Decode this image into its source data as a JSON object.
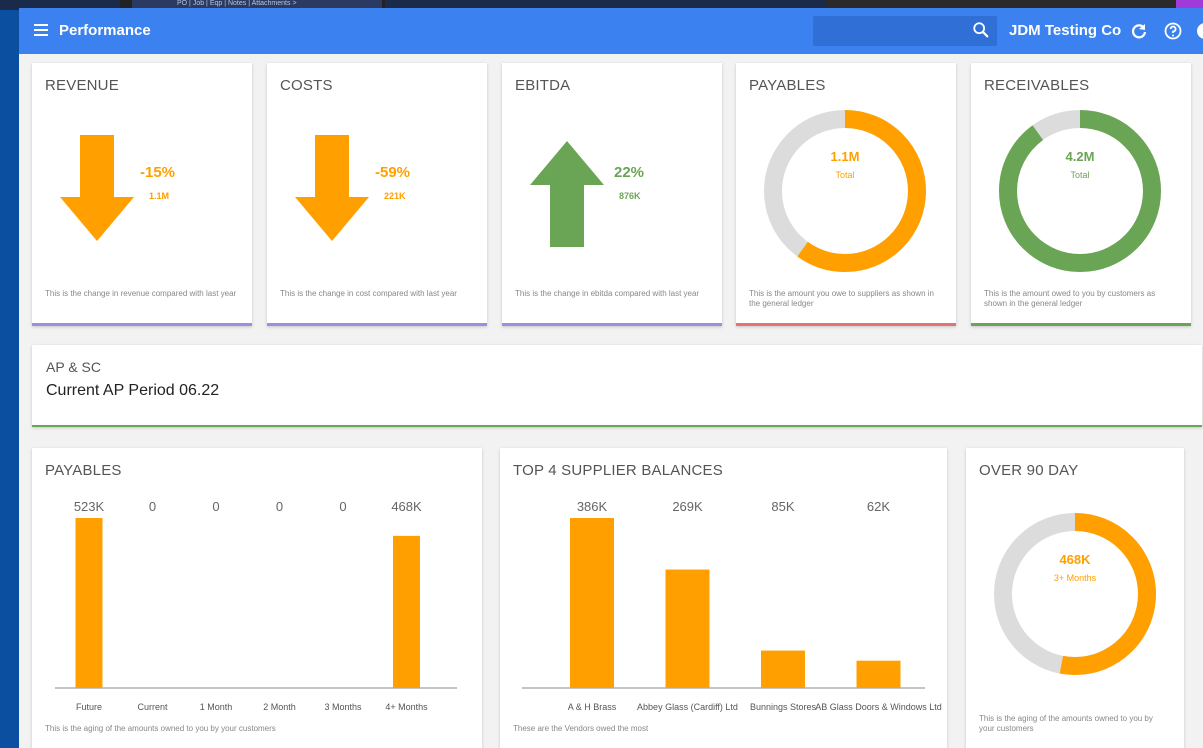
{
  "background_tabs": "PO | Job | Eqp | Notes | Attachments   >",
  "appbar": {
    "title": "Performance",
    "company": "JDM Testing Co",
    "color": "#3b82f0"
  },
  "kpis": {
    "revenue": {
      "title": "REVENUE",
      "direction": "down",
      "percent": "-15%",
      "amount": "1.1M",
      "footer": "This is the change in revenue compared with last year",
      "color": "#ffa000"
    },
    "costs": {
      "title": "COSTS",
      "direction": "down",
      "percent": "-59%",
      "amount": "221K",
      "footer": "This is the change in cost compared with last year",
      "color": "#ffa000"
    },
    "ebitda": {
      "title": "EBITDA",
      "direction": "up",
      "percent": "22%",
      "amount": "876K",
      "footer": "This is the change in ebitda compared with last year",
      "color": "#6aa556"
    },
    "payables": {
      "title": "PAYABLES",
      "value": "1.1M",
      "label": "Total",
      "fraction": 0.6,
      "footer": "This is the amount you owe to suppliers as shown in the general ledger",
      "color": "#ffa000"
    },
    "receivables": {
      "title": "RECEIVABLES",
      "value": "4.2M",
      "label": "Total",
      "fraction": 0.9,
      "footer": "This is the amount owed to you by customers as shown in the general ledger",
      "color": "#6aa556"
    }
  },
  "apsc": {
    "title": "AP & SC",
    "period": "Current AP Period 06.22"
  },
  "payables_chart": {
    "title": "PAYABLES",
    "footer": "This is the aging of the amounts owned to you by your customers"
  },
  "suppliers_chart": {
    "title": "TOP 4 SUPPLIER BALANCES",
    "footer": "These are the Vendors owed the most"
  },
  "over90": {
    "title": "OVER 90 DAY",
    "value": "468K",
    "label": "3+ Months",
    "fraction": 0.53,
    "footer": "This is the aging of the amounts owned to you by your customers",
    "color": "#ffa000"
  },
  "chart_data": [
    {
      "type": "bar",
      "title": "PAYABLES",
      "categories": [
        "Future",
        "Current",
        "1 Month",
        "2 Month",
        "3 Months",
        "4+ Months"
      ],
      "values": [
        523,
        0,
        0,
        0,
        0,
        468
      ],
      "labels": [
        "523K",
        "0",
        "0",
        "0",
        "0",
        "468K"
      ],
      "unit": "K",
      "color": "#ffa000"
    },
    {
      "type": "bar",
      "title": "TOP 4 SUPPLIER BALANCES",
      "categories": [
        "A & H Brass",
        "Abbey Glass (Cardiff) Ltd",
        "Bunnings Stores",
        "AB Glass Doors & Windows Ltd"
      ],
      "values": [
        386,
        269,
        85,
        62
      ],
      "labels": [
        "386K",
        "269K",
        "85K",
        "62K"
      ],
      "unit": "K",
      "color": "#ffa000"
    }
  ]
}
